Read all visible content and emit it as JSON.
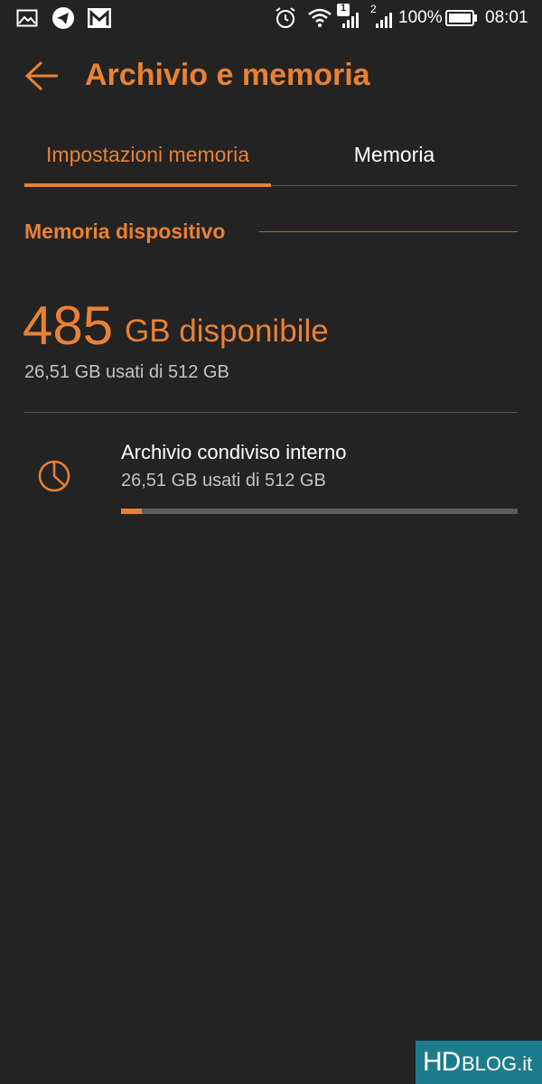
{
  "status_bar": {
    "sim2_label": "2",
    "data_badge": "1",
    "battery_percent": "100%",
    "time": "08:01",
    "icons": [
      "gallery-icon",
      "telegram-icon",
      "gmail-icon",
      "alarm-icon",
      "wifi-icon",
      "signal-icon",
      "signal-icon",
      "battery-icon"
    ]
  },
  "header": {
    "title": "Archivio e memoria",
    "back_icon": "arrow-back-icon"
  },
  "tabs": [
    {
      "label": "Impostazioni memoria",
      "active": true
    },
    {
      "label": "Memoria",
      "active": false
    }
  ],
  "section": {
    "title": "Memoria dispositivo"
  },
  "summary": {
    "available_number": "485",
    "available_unit": "GB disponibile",
    "used_text": "26,51 GB usati di 512 GB"
  },
  "storage_item": {
    "icon": "pie-chart-icon",
    "title": "Archivio condiviso interno",
    "subtitle": "26,51 GB usati di 512 GB",
    "used_fraction": 0.052
  },
  "watermark": {
    "brand_hd": "HD",
    "brand_rest": "BLOG.it"
  },
  "colors": {
    "accent": "#e98134",
    "background": "#232323",
    "watermark": "#1d7c8c"
  }
}
